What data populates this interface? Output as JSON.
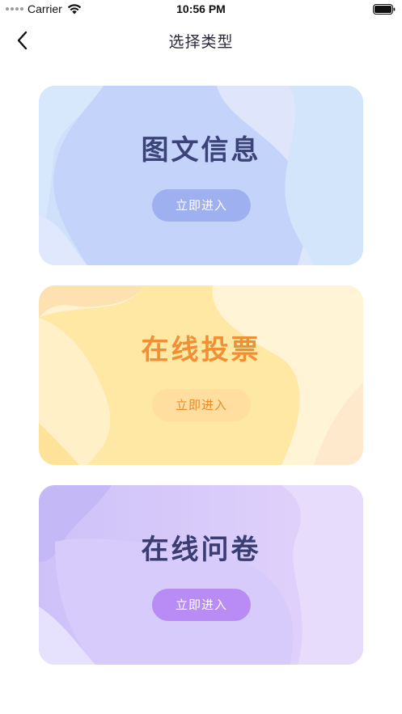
{
  "status_bar": {
    "carrier": "Carrier",
    "time": "10:56 PM"
  },
  "nav": {
    "title": "选择类型",
    "back_icon": "chevron-left-icon"
  },
  "cards": [
    {
      "title": "图文信息",
      "button_label": "立即进入",
      "title_color": "#3b4379",
      "button_color": "#9fb0f1"
    },
    {
      "title": "在线投票",
      "button_label": "立即进入",
      "title_color": "#ef9034",
      "button_color": "#ffdea0"
    },
    {
      "title": "在线问卷",
      "button_label": "立即进入",
      "title_color": "#3a3d72",
      "button_color": "#b98bf5"
    }
  ]
}
